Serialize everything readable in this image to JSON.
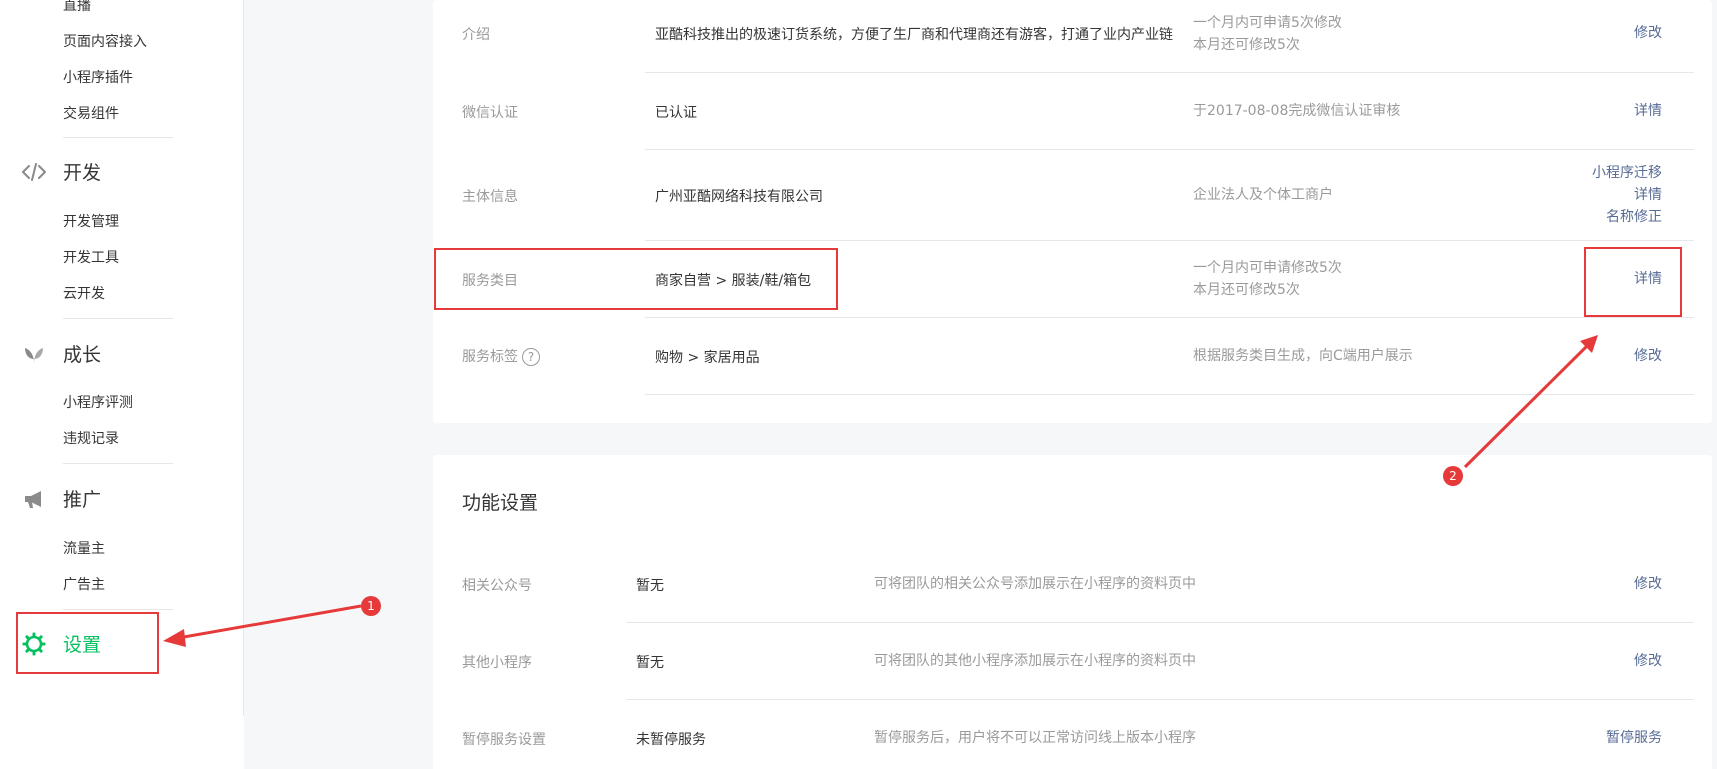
{
  "sidebar": {
    "links": [
      {
        "label": "直播"
      },
      {
        "label": "页面内容接入"
      },
      {
        "label": "小程序插件"
      },
      {
        "label": "交易组件"
      },
      {
        "label": "开发管理"
      },
      {
        "label": "开发工具"
      },
      {
        "label": "云开发"
      },
      {
        "label": "小程序评测"
      },
      {
        "label": "违规记录"
      },
      {
        "label": "流量主"
      },
      {
        "label": "广告主"
      }
    ],
    "groups": [
      {
        "label": "开发",
        "icon": "code-icon"
      },
      {
        "label": "成长",
        "icon": "leaf-icon"
      },
      {
        "label": "推广",
        "icon": "megaphone-icon"
      },
      {
        "label": "设置",
        "icon": "gear-icon",
        "active": true
      }
    ]
  },
  "basic_info": {
    "rows": [
      {
        "label": "介绍",
        "value": "亚酷科技推出的极速订货系统，方便了生厂商和代理商还有游客，打通了业内产业链",
        "desc": [
          "一个月内可申请5次修改",
          "本月还可修改5次"
        ],
        "actions": [
          "修改"
        ]
      },
      {
        "label": "微信认证",
        "value": "已认证",
        "desc": [
          "于2017-08-08完成微信认证审核"
        ],
        "actions": [
          "详情"
        ]
      },
      {
        "label": "主体信息",
        "value": "广州亚酷网络科技有限公司",
        "desc": [
          "企业法人及个体工商户"
        ],
        "actions": [
          "小程序迁移",
          "详情",
          "名称修正"
        ]
      },
      {
        "label": "服务类目",
        "value": "商家自营 > 服装/鞋/箱包",
        "desc": [
          "一个月内可申请修改5次",
          "本月还可修改5次"
        ],
        "actions": [
          "详情"
        ]
      },
      {
        "label": "服务标签",
        "help": "?",
        "value": "购物 > 家居用品",
        "desc": [
          "根据服务类目生成，向C端用户展示"
        ],
        "actions": [
          "修改"
        ]
      }
    ]
  },
  "feature_settings": {
    "title": "功能设置",
    "rows": [
      {
        "label": "相关公众号",
        "value": "暂无",
        "desc": "可将团队的相关公众号添加展示在小程序的资料页中",
        "action": "修改"
      },
      {
        "label": "其他小程序",
        "value": "暂无",
        "desc": "可将团队的其他小程序添加展示在小程序的资料页中",
        "action": "修改"
      },
      {
        "label": "暂停服务设置",
        "value": "未暂停服务",
        "desc": "暂停服务后，用户将不可以正常访问线上版本小程序",
        "action": "暂停服务"
      }
    ]
  },
  "annotations": {
    "badges": [
      "1",
      "2"
    ],
    "color": "#e63a3a"
  },
  "colors": {
    "accent": "#07c160",
    "link": "#576b95",
    "annotation": "#e63a3a"
  }
}
